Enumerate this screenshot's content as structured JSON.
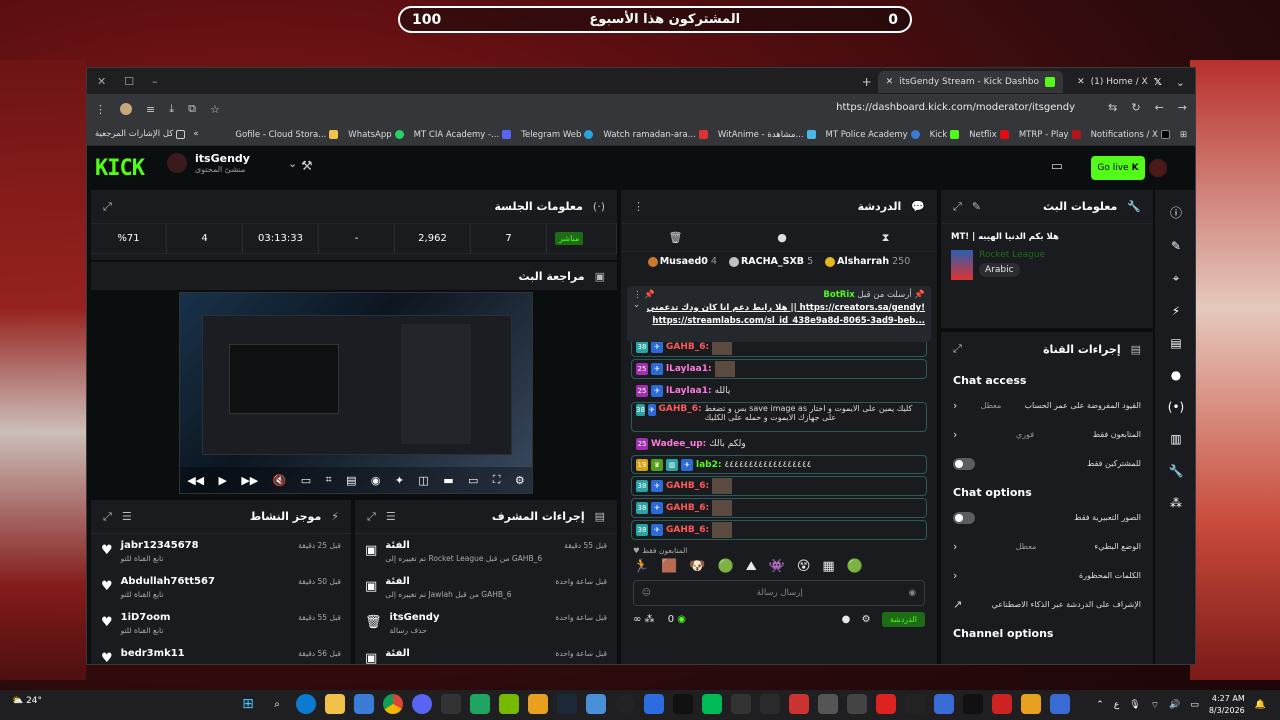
{
  "goal": {
    "title": "المشتركون هذا الأسبوع",
    "current": "0",
    "target": "100"
  },
  "browser": {
    "tabs": [
      {
        "label": "itsGendy Stream - Kick Dashbo"
      },
      {
        "label": "(1) Home / X"
      }
    ],
    "url": "https://dashboard.kick.com/moderator/itsgendy",
    "bookmarks_all": "كل الإشارات المرجعية",
    "bookmarks": [
      "Gofile - Cloud Stora...",
      "WhatsApp",
      "MT CIA Academy -...",
      "Telegram Web",
      "Watch ramadan-ara...",
      "WitAnime - مشاهدة...",
      "MT Police Academy",
      "Kick",
      "Netflix",
      "MTRP - Play",
      "Notifications / X"
    ]
  },
  "kick": {
    "logo": "KICK",
    "username": "itsGendy",
    "role": "منشئ المحتوى",
    "go_live": "Go live",
    "session": {
      "title": "معلومات الجلسة",
      "live": "مباشر",
      "stats": [
        "%71",
        "4",
        "03:13:33",
        "-",
        "2,962",
        "7"
      ]
    },
    "preview": {
      "title": "مراجعة البث"
    },
    "chat": {
      "title": "الدردشة",
      "leaders": [
        {
          "name": "Musaed0",
          "count": "4",
          "color": "#c97a2b"
        },
        {
          "name": "RACHA_SXB",
          "count": "5",
          "color": "#c0c0c0"
        },
        {
          "name": "Alsharrah",
          "count": "250",
          "color": "#e5b81a"
        }
      ],
      "pinned": {
        "by": "أرسلت من قبل",
        "user": "BotRix",
        "text": "هلا رابط دعم انا كان ودك تدعمني || https://creators.sa/gendy!",
        "link": "https://streamlabs.com/sl_id_438e9a8d-8065-3ad9-beb..."
      },
      "messages": [
        {
          "user": "GAHB_6:",
          "color": "#ff5a5a",
          "text": "",
          "img": true
        },
        {
          "user": "lLaylaa1:",
          "color": "#ff7ad9",
          "text": "",
          "img": true
        },
        {
          "user": "lLaylaa1:",
          "color": "#ff7ad9",
          "text": "يالله",
          "img": false
        },
        {
          "user": "GAHB_6:",
          "color": "#ff5a5a",
          "text": "بس و تضغط save image as كليك يمين على الايموت و اختار على جهازك الايموت و حمله على الكليك",
          "img": false
        },
        {
          "user": "Wadee_up:",
          "color": "#ff7ad9",
          "text": "ولكم بالك",
          "img": false
        },
        {
          "user": "lab2:",
          "color": "#53fc18",
          "text": "٤٤٤٤٤٤٤٤٤٤٤٤٤٤٤٤٤٤",
          "img": false
        },
        {
          "user": "GAHB_6:",
          "color": "#ff5a5a",
          "text": "",
          "img": true
        },
        {
          "user": "GAHB_6:",
          "color": "#ff5a5a",
          "text": "",
          "img": true
        },
        {
          "user": "GAHB_6:",
          "color": "#ff5a5a",
          "text": "",
          "img": true
        }
      ],
      "followers_only": "المتابعون فقط",
      "input_placeholder": "إرسال رسالة",
      "points": "0",
      "send": "الدردشة"
    },
    "activity": {
      "title": "موجز النشاط",
      "items": [
        {
          "name": "jabr12345678",
          "sub": "تابع القناة للتو",
          "time": "قبل 25 دقيقة"
        },
        {
          "name": "Abdullah76tt567",
          "sub": "تابع القناة للتو",
          "time": "قبل 50 دقيقة"
        },
        {
          "name": "1iD7oom",
          "sub": "تابع القناة للتو",
          "time": "قبل 55 دقيقة"
        },
        {
          "name": "bedr3mk11",
          "sub": "",
          "time": "قبل 56 دقيقة"
        }
      ]
    },
    "modactions": {
      "title": "إجراءات المشرف",
      "items": [
        {
          "name": "الفئة",
          "sub": "تم تغييره إلى Rocket League من قبل GAHB_6",
          "time": "قبل 55 دقيقة"
        },
        {
          "name": "الفئة",
          "sub": "تم تغييره إلى Jawlah من قبل GAHB_6",
          "time": "قبل ساعة واحدة"
        },
        {
          "name": "itsGendy",
          "sub": "حذف رسالة",
          "time": "قبل ساعة واحدة"
        },
        {
          "name": "الفئة",
          "sub": "",
          "time": "قبل ساعة واحدة"
        }
      ]
    },
    "streaminfo": {
      "title": "معلومات البث",
      "stream_title": "MT! | هلا بكم الدنيا الهيبه",
      "category": "Rocket League",
      "language": "Arabic"
    },
    "channel": {
      "title": "إجراءات القناة",
      "access_title": "Chat access",
      "access_rows": [
        {
          "label": "القيود المفروضة على عمر الحساب",
          "value": "معطل"
        },
        {
          "label": "المتابعون فقط",
          "value": "فوري"
        },
        {
          "label": "للمشتركين فقط",
          "value": ""
        }
      ],
      "options_title": "Chat options",
      "options_rows": [
        {
          "label": "الصور التعبيرية فقط",
          "value": ""
        },
        {
          "label": "الوضع البطيء",
          "value": "معطل"
        },
        {
          "label": "الكلمات المحظورة",
          "value": ""
        },
        {
          "label": "الإشراف على الدردشة عبر الذكاء الاصطناعي",
          "value": ""
        }
      ],
      "more_title": "Channel options"
    }
  },
  "taskbar": {
    "weather": "24°",
    "time": "4:27 AM",
    "date": "8/3/2026",
    "lang": "ع"
  }
}
